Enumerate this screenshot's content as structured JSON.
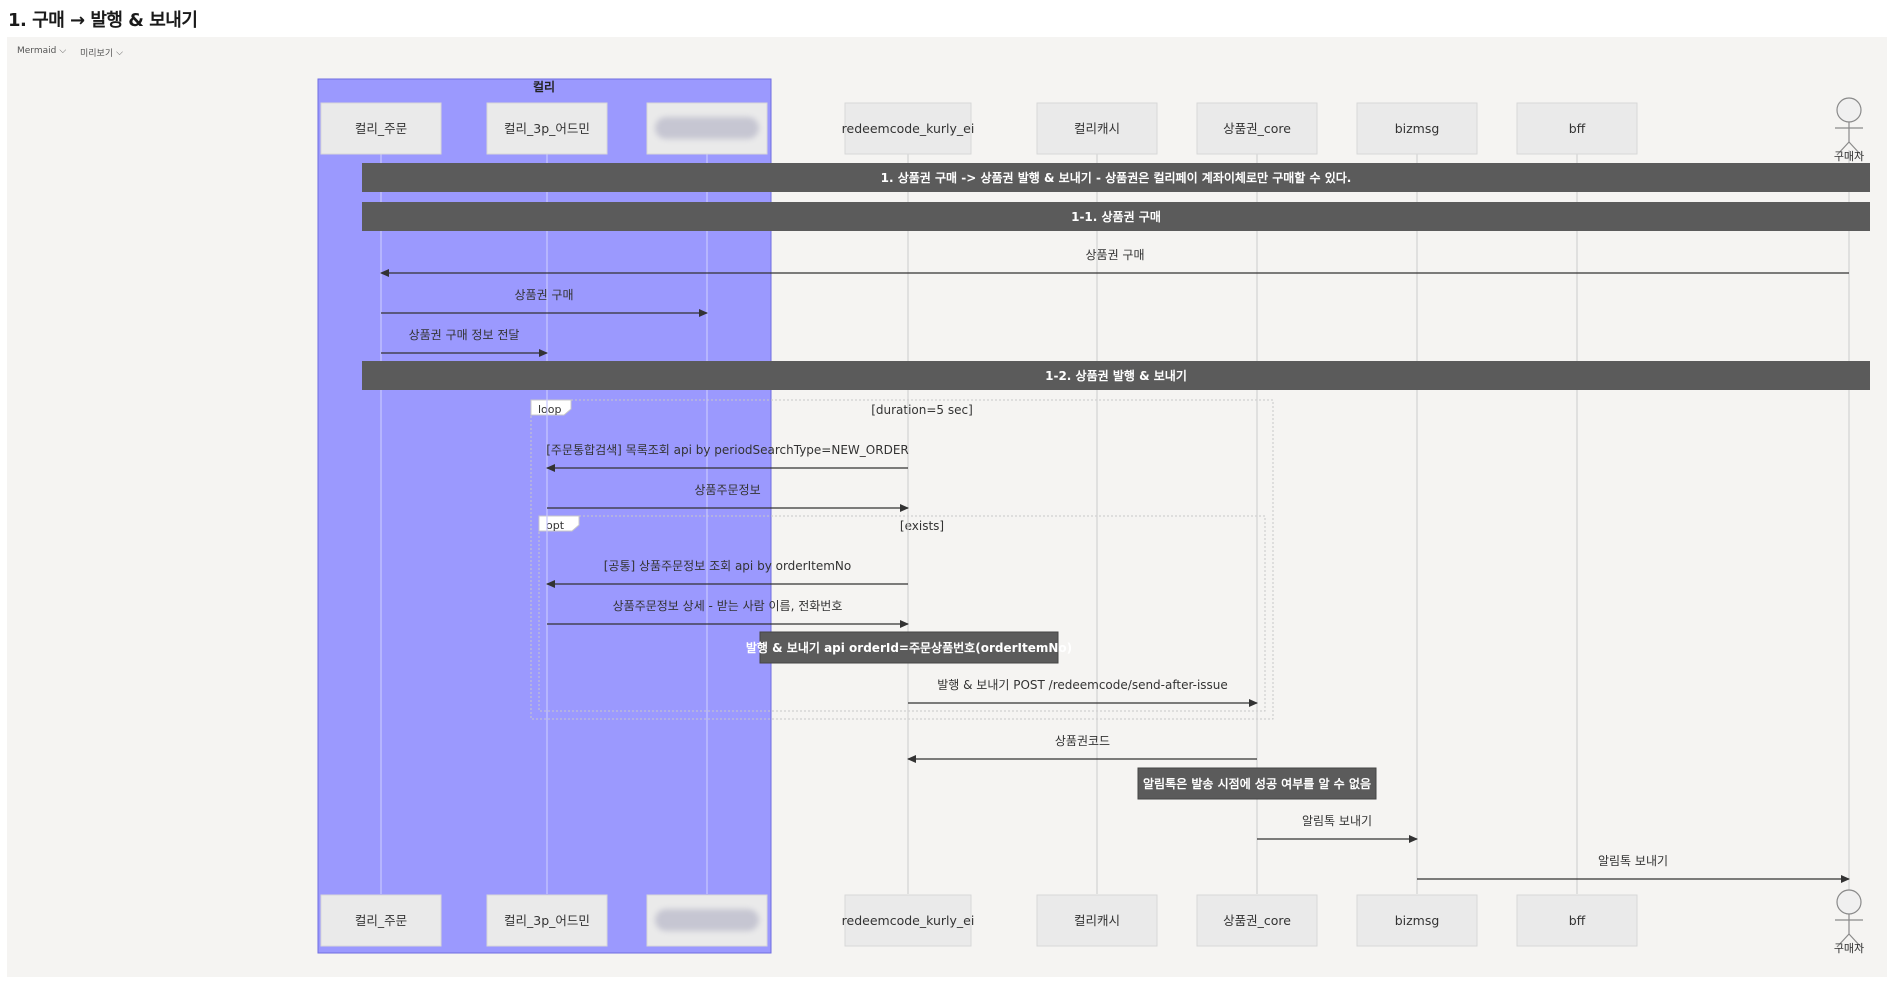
{
  "page": {
    "title": "1. 구매 → 발행 & 보내기"
  },
  "toolbar": {
    "mode": "Mermaid",
    "preview": "미리보기"
  },
  "group": {
    "label": "컬리",
    "fill": "#9b99fe"
  },
  "participants": [
    {
      "id": "order",
      "label": "컬리_주문",
      "type": "box",
      "in_group": true
    },
    {
      "id": "admin3p",
      "label": "컬리_3p_어드민",
      "type": "box",
      "in_group": true
    },
    {
      "id": "hidden",
      "label": "",
      "type": "box",
      "in_group": true,
      "redacted": true
    },
    {
      "id": "redeem",
      "label": "redeemcode_kurly_ei",
      "type": "box"
    },
    {
      "id": "cash",
      "label": "컬리캐시",
      "type": "box"
    },
    {
      "id": "core",
      "label": "상품권_core",
      "type": "box"
    },
    {
      "id": "bizmsg",
      "label": "bizmsg",
      "type": "box"
    },
    {
      "id": "bff",
      "label": "bff",
      "type": "box"
    },
    {
      "id": "buyer",
      "label": "구매자",
      "type": "actor"
    }
  ],
  "sections": [
    {
      "text": "1. 상품권 구매 -> 상품권 발행 & 보내기 - 상품권은 컬리페이 계좌이체로만 구매할 수 있다."
    },
    {
      "text": "1-1. 상품권 구매"
    },
    {
      "text": "1-2. 상품권 발행 & 보내기"
    }
  ],
  "messages": [
    {
      "from": "buyer",
      "to": "order",
      "text": "상품권 구매"
    },
    {
      "from": "order",
      "to": "hidden",
      "text": "상품권 구매"
    },
    {
      "from": "order",
      "to": "admin3p",
      "text": "상품권 구매 정보 전달"
    },
    {
      "from": "redeem",
      "to": "admin3p",
      "text": "[주문통합검색] 목록조회 api by periodSearchType=NEW_ORDER"
    },
    {
      "from": "admin3p",
      "to": "redeem",
      "text": "상품주문정보"
    },
    {
      "from": "redeem",
      "to": "admin3p",
      "text": "[공통] 상품주문정보 조회 api by orderItemNo"
    },
    {
      "from": "admin3p",
      "to": "redeem",
      "text": "상품주문정보 상세 - 받는 사람 이름, 전화번호"
    },
    {
      "from": "redeem",
      "to": "core",
      "text": "발행 & 보내기 POST /redeemcode/send-after-issue"
    },
    {
      "from": "core",
      "to": "redeem",
      "text": "상품권코드"
    },
    {
      "from": "core",
      "to": "bizmsg",
      "text": "알림톡 보내기"
    },
    {
      "from": "bizmsg",
      "to": "buyer",
      "text": "알림톡 보내기"
    }
  ],
  "notes": [
    {
      "over": "redeem",
      "text": "발행 & 보내기 api orderId=주문상품번호(orderItemNo)"
    },
    {
      "over": "core",
      "text": "알림톡은 발송 시점에 성공 여부를 알 수 없음"
    }
  ],
  "frames": [
    {
      "kind": "loop",
      "condition": "[duration=5 sec]"
    },
    {
      "kind": "opt",
      "condition": "[exists]"
    }
  ],
  "colors": {
    "section_bg": "#5b5b5b",
    "note_bg": "#5b5b5b",
    "box_bg": "#eaeaea",
    "canvas_bg": "#f5f4f2"
  }
}
